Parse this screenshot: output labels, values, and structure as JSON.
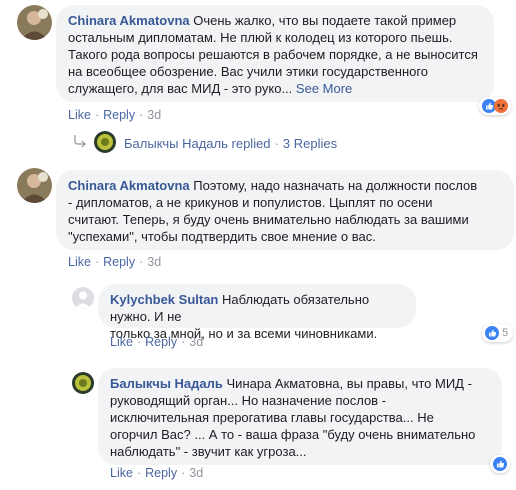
{
  "comments": [
    {
      "author": "Chinara Akmatovna",
      "text_lines": [
        "Очень жалко, что вы подаете такой пример",
        "остальным дипломатам. Не плюй к колодец из которого пьешь.",
        "Такого рода вопросы решаются в рабочем порядке, а не выносится",
        "на всеобщее обозрение. Вас учили этики государственного",
        "служащего, для вас МИД - это руко..."
      ],
      "see_more": "See More",
      "like": "Like",
      "reply": "Reply",
      "time": "3d",
      "reactions": [
        "like-icon",
        "angry-icon"
      ],
      "reply_summary": {
        "replier": "Балыкчы Надаль replied",
        "count": "3 Replies"
      }
    },
    {
      "author": "Chinara Akmatovna",
      "text_lines": [
        "Поэтому, надо назначать на должности послов",
        "- дипломатов, а не крикунов и популистов. Цыплят по осени",
        "считают. Теперь, я буду очень внимательно наблюдать за вашими",
        "\"успехами\", чтобы подтвердить свое мнение о вас."
      ],
      "like": "Like",
      "reply": "Reply",
      "time": "3d"
    }
  ],
  "replies": [
    {
      "author": "Kylychbek Sultan",
      "text_lines": [
        "Наблюдать обязательно нужно. И не",
        "только за мной, но и за всеми чиновниками."
      ],
      "like": "Like",
      "reply": "Reply",
      "time": "3d",
      "reaction_count": "5"
    },
    {
      "author": "Балыкчы Надаль",
      "text_lines": [
        "Чинара Акматовна, вы правы, что МИД -",
        "руководящий орган... Но назначение послов -",
        "исключительная прерогатива главы государства... Не",
        "огорчил Вас? ... А то - ваша фраза \"буду очень внимательно",
        "наблюдать\" - звучит как угроза..."
      ],
      "like": "Like",
      "reply": "Reply",
      "time": "3d"
    }
  ],
  "colors": {
    "link": "#385898",
    "meta": "#90949c",
    "bubble": "#f2f3f5",
    "like_blue": "#3b82f6",
    "angry_orange": "#f0703c"
  }
}
